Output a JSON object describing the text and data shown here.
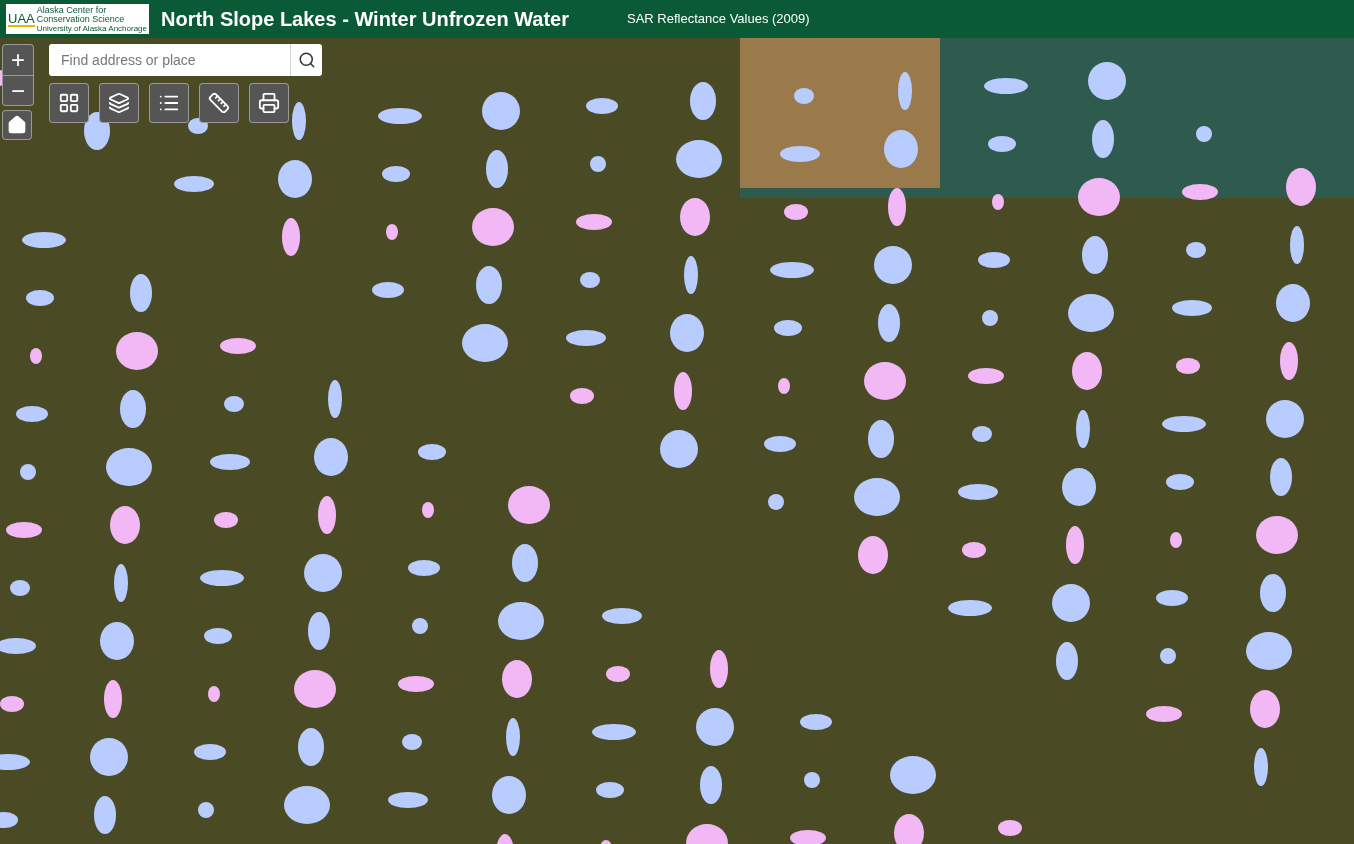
{
  "header": {
    "logo": {
      "mark": "UAA",
      "name_line_1": "Alaska Center for",
      "name_line_2": "Conservation Science",
      "university": "University of Alaska Anchorage"
    },
    "title": "North Slope Lakes - Winter Unfrozen Water",
    "layer": "SAR Reflectance Values (2009)"
  },
  "map": {
    "zoom_in": "+",
    "zoom_out": "−",
    "search": {
      "placeholder": "Find address or place"
    }
  }
}
